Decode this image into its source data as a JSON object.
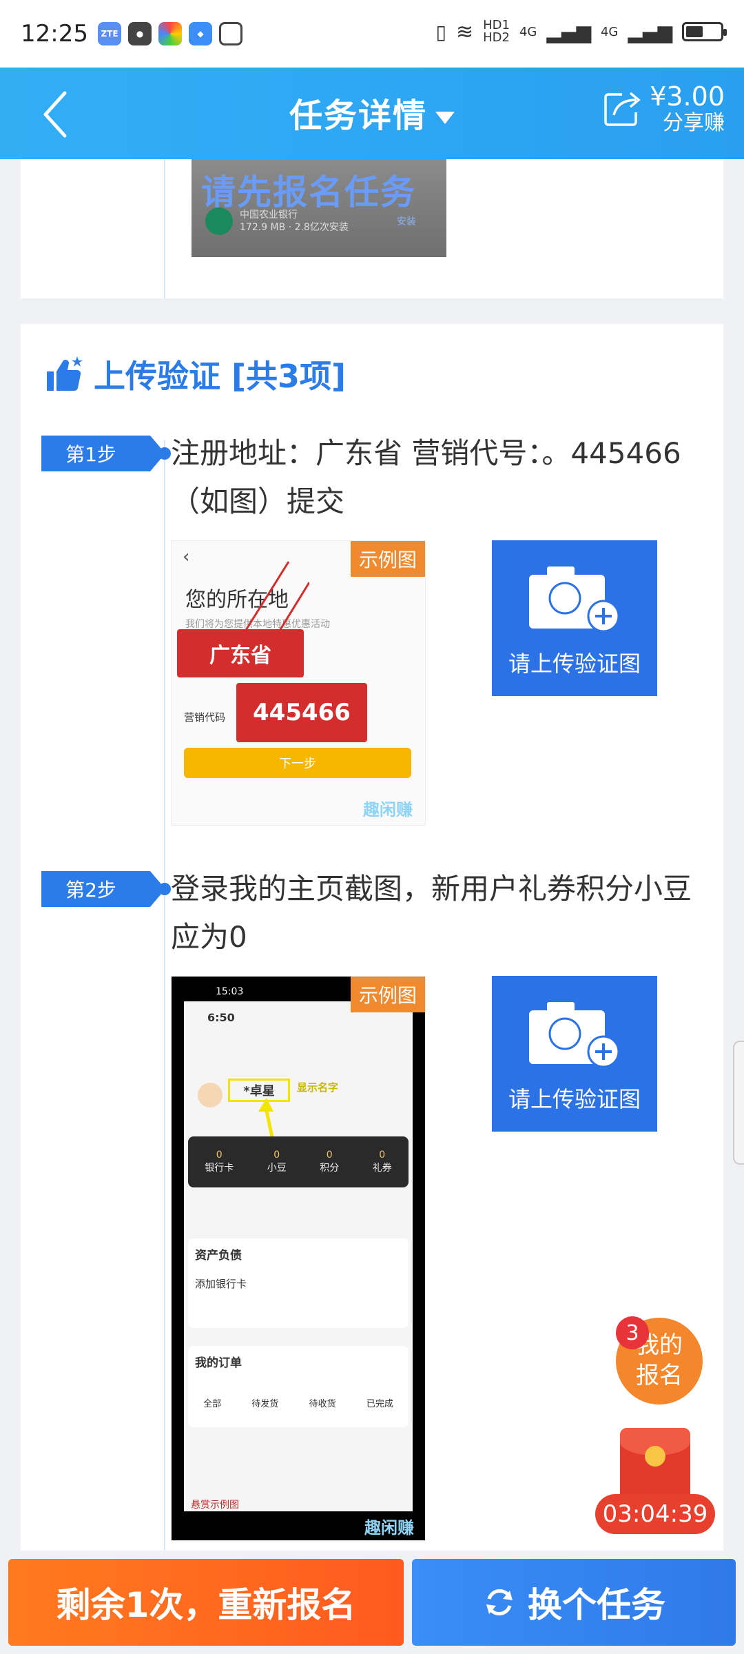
{
  "status_bar": {
    "time": "12:25",
    "network_1": "HD1",
    "network_2": "HD2",
    "signal_1": "4G",
    "signal_2": "4G"
  },
  "header": {
    "title": "任务详情",
    "share_amount": "¥3.00",
    "share_label": "分享赚"
  },
  "top_card": {
    "overlay_text": "请先报名任务",
    "bank_name": "中国农业银行",
    "bank_detail": "172.9 MB · 2.8亿次安装",
    "install": "安装"
  },
  "upload_section": {
    "title": "上传验证 [共3项]"
  },
  "steps": [
    {
      "badge": "第1步",
      "text": "注册地址：广东省 营销代号：。445466（如图）提交",
      "example_tag": "示例图",
      "upload_label": "请上传验证图",
      "example": {
        "heading": "您的所在地",
        "sub": "我们将为您提供本地特惠优惠活动",
        "province": "广东省",
        "code_label": "营销代码",
        "code": "445466",
        "next": "下一步",
        "watermark": "趣闲赚"
      }
    },
    {
      "badge": "第2步",
      "text": "登录我的主页截图，新用户礼券积分小豆应为0",
      "example_tag": "示例图",
      "upload_label": "请上传验证图",
      "example": {
        "phone_time": "15:03",
        "app_time": "6:50",
        "user_name": "*卓星",
        "name_hint": "显示名字",
        "stats": [
          "0",
          "0",
          "0",
          "0"
        ],
        "stat_labels": [
          "银行卡",
          "小豆",
          "积分",
          "礼券"
        ],
        "assets": "资产负债",
        "add_card": "添加银行卡",
        "orders": "我的订单",
        "order_items": [
          "全部",
          "待发货",
          "待收货",
          "已完成"
        ],
        "caption": "悬赏示例图",
        "watermark": "趣闲赚"
      }
    }
  ],
  "bottom": {
    "reapply_label": "剩余1次，重新报名",
    "change_label": "换个任务"
  },
  "floating": {
    "signup_count": "3",
    "signup_label_1": "我的",
    "signup_label_2": "报名",
    "timer": "03:04:39"
  },
  "colors": {
    "primary": "#2b7ce8",
    "header": "#33aef5",
    "orange": "#ff6a1f",
    "tag": "#f08a2e"
  }
}
